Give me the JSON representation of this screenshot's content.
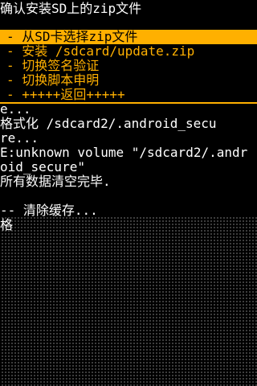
{
  "menu": {
    "title": "确认安装SD上的zip文件",
    "items": [
      {
        "label": "- 从SD卡选择zip文件",
        "selected": true
      },
      {
        "label": "- 安装 /sdcard/update.zip",
        "selected": false
      },
      {
        "label": "- 切换签名验证",
        "selected": false
      },
      {
        "label": "- 切换脚本申明",
        "selected": false
      },
      {
        "label": "- +++++返回+++++",
        "selected": false
      }
    ]
  },
  "colors": {
    "background": "#000000",
    "text": "#ffffff",
    "menu_highlight": "#ffb000"
  },
  "log": [
    "e...",
    "格式化 /sdcard2/.android_secu",
    "re...",
    "E:unknown volume \"/sdcard2/.andr",
    "oid_secure\"",
    "所有数据清空完毕.",
    "",
    "-- 清除缓存...",
    "格"
  ]
}
